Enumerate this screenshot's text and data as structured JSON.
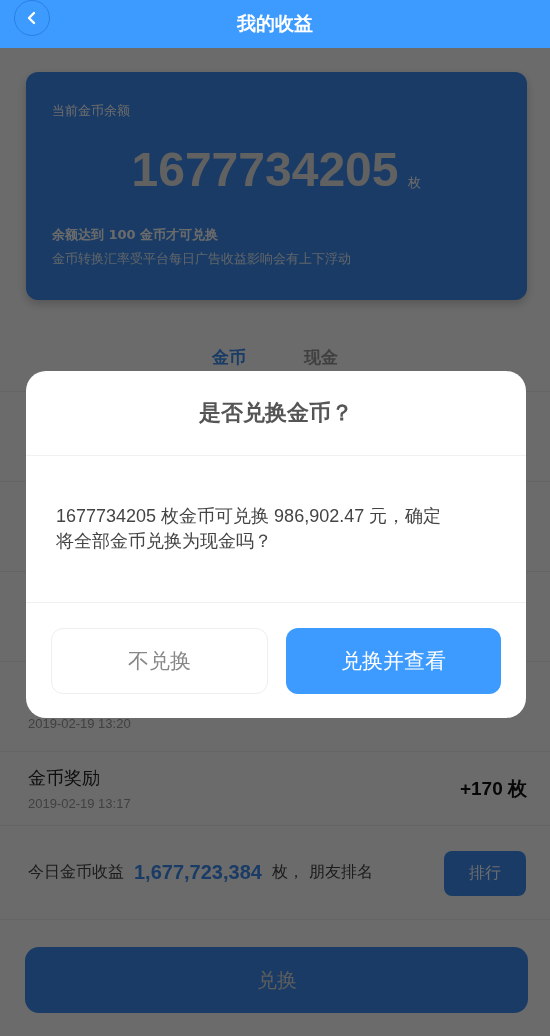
{
  "header": {
    "title": "我的收益"
  },
  "balance_card": {
    "label": "当前金币余额",
    "amount": "1677734205",
    "unit": "枚",
    "rule": "余额达到 100 金币才可兑换",
    "note": "金币转换汇率受平台每日广告收益影响会有上下浮动"
  },
  "tabs": [
    {
      "label": "金币",
      "selected": true
    },
    {
      "label": "现金",
      "selected": false
    }
  ],
  "records": [
    {
      "time": "2019-02-19 13:20"
    },
    {
      "title": "金币奖励",
      "time": "2019-02-19 13:17",
      "amount": "+170 枚"
    }
  ],
  "summary": {
    "label": "今日金币收益",
    "amount": "1,677,723,384",
    "text": "枚，  朋友排名",
    "button": "排行"
  },
  "exchange_button": "兑换",
  "dialog": {
    "title": "是否兑换金币？",
    "message": "1677734205 枚金币可兑换 986,902.47 元，确定将全部金币兑换为现金吗？",
    "buttons": [
      {
        "label": "不兑换",
        "kind": "secondary"
      },
      {
        "label": "兑换并查看",
        "kind": "primary"
      }
    ]
  }
}
